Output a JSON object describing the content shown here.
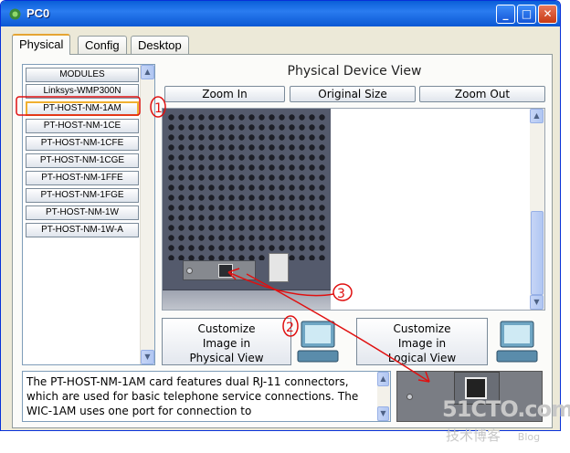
{
  "window": {
    "title": "PC0",
    "accent": "#0a5fd8"
  },
  "tabs": [
    {
      "label": "Physical",
      "active": true
    },
    {
      "label": "Config",
      "active": false
    },
    {
      "label": "Desktop",
      "active": false
    }
  ],
  "modules": {
    "header": "MODULES",
    "items": [
      "Linksys-WMP300N",
      "PT-HOST-NM-1AM",
      "PT-HOST-NM-1CE",
      "PT-HOST-NM-1CFE",
      "PT-HOST-NM-1CGE",
      "PT-HOST-NM-1FFE",
      "PT-HOST-NM-1FGE",
      "PT-HOST-NM-1W",
      "PT-HOST-NM-1W-A"
    ],
    "selected": "PT-HOST-NM-1AM"
  },
  "physical_view": {
    "title": "Physical Device View",
    "zoom_in": "Zoom In",
    "original_size": "Original Size",
    "zoom_out": "Zoom Out"
  },
  "customize": {
    "physical": [
      "Customize",
      "Image in",
      "Physical View"
    ],
    "logical": [
      "Customize",
      "Image in",
      "Logical View"
    ]
  },
  "description": "The PT-HOST-NM-1AM card features dual RJ-11 connectors, which are used for basic telephone service connections. The WIC-1AM uses one port for connection to",
  "annotations": {
    "one": "1",
    "two": "2",
    "three": "3",
    "color": "#e01010"
  },
  "watermark": {
    "main": "51CTO.com",
    "sub": "技术博客",
    "blog": "Blog"
  }
}
